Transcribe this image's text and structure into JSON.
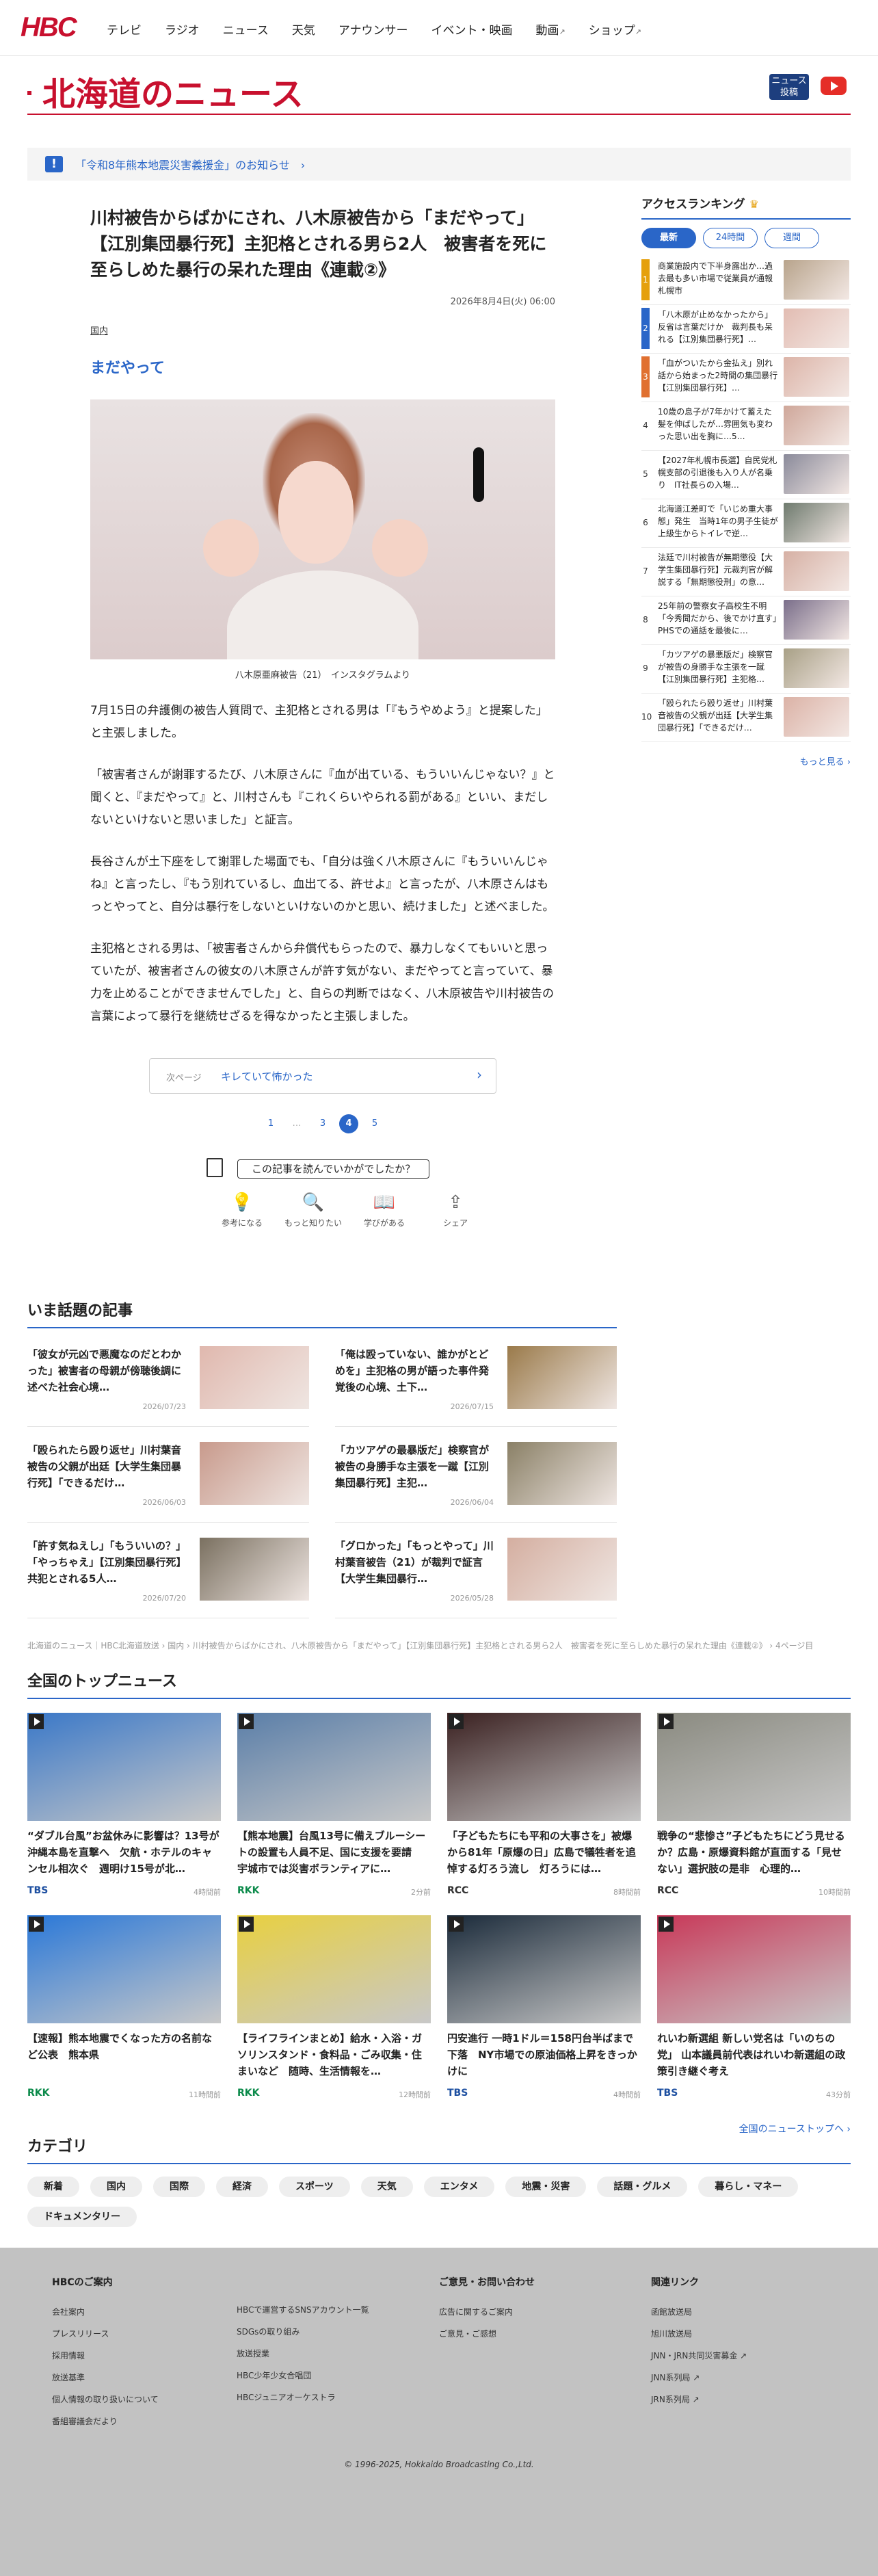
{
  "header": {
    "logo": "HBC",
    "nav": [
      {
        "label": "テレビ"
      },
      {
        "label": "ラジオ"
      },
      {
        "label": "ニュース"
      },
      {
        "label": "天気"
      },
      {
        "label": "アナウンサー"
      },
      {
        "label": "イベント・映画"
      },
      {
        "label": "動画",
        "ext": "↗"
      },
      {
        "label": "ショップ",
        "ext": "↗"
      }
    ]
  },
  "section": {
    "title": "北海道のニュース",
    "news_post": "ニュース\n投稿"
  },
  "alert": {
    "icon": "!",
    "text": "「令和8年熊本地震災害義援金」のお知らせ　›"
  },
  "article": {
    "title": "川村被告からばかにされ、八木原被告から「まだやって」【江別集団暴行死】主犯格とされる男ら2人　被害者を死に至らしめた暴行の呆れた理由《連載②》",
    "date": "2026年8月4日(火) 06:00",
    "category": "国内",
    "subheading": "まだやって",
    "caption": "八木原亜麻被告（21）　インスタグラムより",
    "paragraphs": [
      "7月15日の弁護側の被告人質問で、主犯格とされる男は「『もうやめよう』と提案した」と主張しました。",
      "「被害者さんが謝罪するたび、八木原さんに『血が出ている、もういいんじゃない？』と聞くと、『まだやって』と、川村さんも『これくらいやられる罰がある』といい、まだしないといけないと思いました」と証言。",
      "長谷さんが土下座をして謝罪した場面でも、「自分は強く八木原さんに『もういいんじゃね』と言ったし、『もう別れているし、血出てる、許せよ』と言ったが、八木原さんはもっとやってと、自分は暴行をしないといけないのかと思い、続けました」と述べました。",
      "主犯格とされる男は、「被害者さんから弁償代もらったので、暴力しなくてもいいと思っていたが、被害者さんの彼女の八木原さんが許す気がない、まだやってと言っていて、暴力を止めることができませんでした」と、自らの判断ではなく、八木原被告や川村被告の言葉によって暴行を継続せざるを得なかったと主張しました。"
    ],
    "next": {
      "label": "次ページ",
      "value": "キレていて怖かった",
      "chevron": "›"
    },
    "pages": [
      "1",
      "…",
      "3",
      "4",
      "5"
    ],
    "current_page": "4",
    "feedback_q": "この記事を読んでいかがでしたか？",
    "actions": [
      {
        "icon": "💡",
        "label": "参考になる"
      },
      {
        "icon": "🔍",
        "label": "もっと知りたい"
      },
      {
        "icon": "📖",
        "label": "学びがある"
      },
      {
        "icon": "⇪",
        "label": "シェア"
      }
    ]
  },
  "ranking": {
    "title": "アクセスランキング",
    "crown": "♛",
    "tabs": [
      "最新",
      "24時間",
      "週間"
    ],
    "items": [
      {
        "rank": "1",
        "text": "商業施設内で下半身露出か…過去最も多い市場で従業員が通報　札幌市",
        "color": "#b8a48c"
      },
      {
        "rank": "2",
        "text": "「八木原が止めなかったから」反省は言葉だけか　裁判長も呆れる【江別集団暴行死】…",
        "color": "#e2bcb2"
      },
      {
        "rank": "3",
        "text": "「血がついたから金払え」別れ話から始まった2時間の集団暴行【江別集団暴行死】…",
        "color": "#dcb4a8"
      },
      {
        "rank": "4",
        "text": "10歳の息子が7年かけて蓄えた髪を伸ばしたが…雰囲気も変わった思い出を胸に…5…",
        "color": "#cfa79a"
      },
      {
        "rank": "5",
        "text": "【2027年札幌市長選】自民党札幌支部の引退後も入り人が名乗り　IT社長らの入場…",
        "color": "#8a8a9a"
      },
      {
        "rank": "6",
        "text": "北海道江差町で「いじめ重大事態」発生　当時1年の男子生徒が上級生からトイレで逆…",
        "color": "#6e7a6e"
      },
      {
        "rank": "7",
        "text": "法廷で川村被告が無期懲役【大学生集団暴行死】元裁判官が解説する「無期懲役刑」の意…",
        "color": "#d6b0a4"
      },
      {
        "rank": "8",
        "text": "25年前の警察女子高校生不明「今秀聞だから、後でかけ直す」PHSでの通話を最後に…",
        "color": "#7a6e8a"
      },
      {
        "rank": "9",
        "text": "「カツアゲの暴悪版だ」検察官が被告の身勝手な主張を一蹴【江別集団暴行死】主犯格…",
        "color": "#a8a086"
      },
      {
        "rank": "10",
        "text": "「殴られたら殴り返せ」川村葉音被告の父親が出廷【大学生集団暴行死】「できるだけ…",
        "color": "#dbb2a6"
      }
    ],
    "more": "もっと見る ›"
  },
  "trending": {
    "title": "いま話題の記事",
    "items": [
      {
        "title": "「彼女が元凶で悪魔なのだとわかった」被害者の母親が傍聴後調に述べた社会心境…",
        "date": "2026/07/23",
        "color": "#e0b8ae"
      },
      {
        "title": "「俺は殴っていない、誰かがとどめを」主犯格の男が語った事件発覚後の心境、土下…",
        "date": "2026/07/15",
        "color": "#9a7a4a"
      },
      {
        "title": "「殴られたら殴り返せ」川村葉音被告の父親が出廷【大学生集団暴行死】「できるだけ…",
        "date": "2026/06/03",
        "color": "#c89a8c"
      },
      {
        "title": "「カツアゲの最暴版だ」検察官が被告の身勝手な主張を一蹴【江別集団暴行死】主犯…",
        "date": "2026/06/04",
        "color": "#8a8066"
      },
      {
        "title": "「許す気ねえし」「もういいの？」「やっちゃえ」【江別集団暴行死】共犯とされる5人…",
        "date": "2026/07/20",
        "color": "#7a7060"
      },
      {
        "title": "「グロかった」「もっとやって」川村葉音被告（21）が裁判で証言【大学生集団暴行…",
        "date": "2026/05/28",
        "color": "#d4aea0"
      }
    ]
  },
  "breadcrumb": "北海道のニュース｜HBC北海道放送 › 国内 › 川村被告からばかにされ、八木原被告から「まだやって」【江別集団暴行死】主犯格とされる男ら2人　被害者を死に至らしめた暴行の呆れた理由《連載②》 › 4ページ目",
  "top_news": {
    "title": "全国のトップニュース",
    "items": [
      {
        "title": "“ダブル台風”お盆休みに影響は？13号が沖縄本島を直撃へ　欠航・ホテルのキャンセル相次ぐ　週明け15号が北…",
        "source": "TBS",
        "src_color": "#1d4fa0",
        "time": "4時間前",
        "color": "#3a78c8"
      },
      {
        "title": "【熊本地震】台風13号に備えブルーシートの設置も人員不足、国に支援を要請　宇城市では災害ボランティアに…",
        "source": "RKK",
        "src_color": "#0b8a4a",
        "time": "2分前",
        "color": "#5a7ea8"
      },
      {
        "title": "「子どもたちにも平和の大事さを」被爆から81年「原爆の日」広島で犠牲者を追悼する灯ろう流し　灯ろうには…",
        "source": "RCC",
        "src_color": "#333333",
        "time": "8時間前",
        "color": "#3a2020"
      },
      {
        "title": "戦争の“悲惨さ”子どもたちにどう見せるか？広島・原爆資料館が直面する「見せない」選択肢の是非　心理的…",
        "source": "RCC",
        "src_color": "#333333",
        "time": "10時間前",
        "color": "#8a8a80"
      },
      {
        "title": "【速報】熊本地震でくなった方の名前など公表　熊本県",
        "source": "RKK",
        "src_color": "#0b8a4a",
        "time": "11時間前",
        "color": "#2a78d8"
      },
      {
        "title": "【ライフラインまとめ】給水・入浴・ガソリンスタンド・食料品・ごみ収集・住まいなど　随時、生活情報を…",
        "source": "RKK",
        "src_color": "#0b8a4a",
        "time": "12時間前",
        "color": "#e8d040"
      },
      {
        "title": "円安進行 一時1ドル＝158円台半ばまで下落　NY市場での原油価格上昇をきっかけに",
        "source": "TBS",
        "src_color": "#1d4fa0",
        "time": "4時間前",
        "color": "#1a2a3a"
      },
      {
        "title": "れいわ新選組 新しい党名は「いのちの党」 山本議員前代表はれいわ新選組の政策引き継ぐ考え",
        "source": "TBS",
        "src_color": "#1d4fa0",
        "time": "43分前",
        "color": "#c83858"
      }
    ],
    "all": "全国のニューストップへ ›"
  },
  "categories": {
    "title": "カテゴリ",
    "items": [
      "新着",
      "国内",
      "国際",
      "経済",
      "スポーツ",
      "天気",
      "エンタメ",
      "地震・災害",
      "話題・グルメ",
      "暮らし・マネー",
      "ドキュメンタリー"
    ]
  },
  "footer": {
    "cols": [
      {
        "title": "HBCのご案内",
        "links": [
          "会社案内",
          "プレスリリース",
          "採用情報",
          "放送基準",
          "個人情報の取り扱いについて",
          "番組審議会だより"
        ]
      },
      {
        "title": "",
        "links": [
          "HBCで運営するSNSアカウント一覧",
          "SDGsの取り組み",
          "放送授業",
          "HBC少年少女合唱団",
          "HBCジュニアオーケストラ"
        ]
      },
      {
        "title": "ご意見・お問い合わせ",
        "links": [
          "広告に関するご案内",
          "ご意見・ご感想"
        ]
      },
      {
        "title": "関連リンク",
        "links": [
          "函館放送局",
          "旭川放送局",
          "JNN・JRN共同災害募金 ↗",
          "JNN系列局 ↗",
          "JRN系列局 ↗"
        ]
      }
    ],
    "copyright": "© 1996-2025, Hokkaido Broadcasting Co.,Ltd."
  }
}
